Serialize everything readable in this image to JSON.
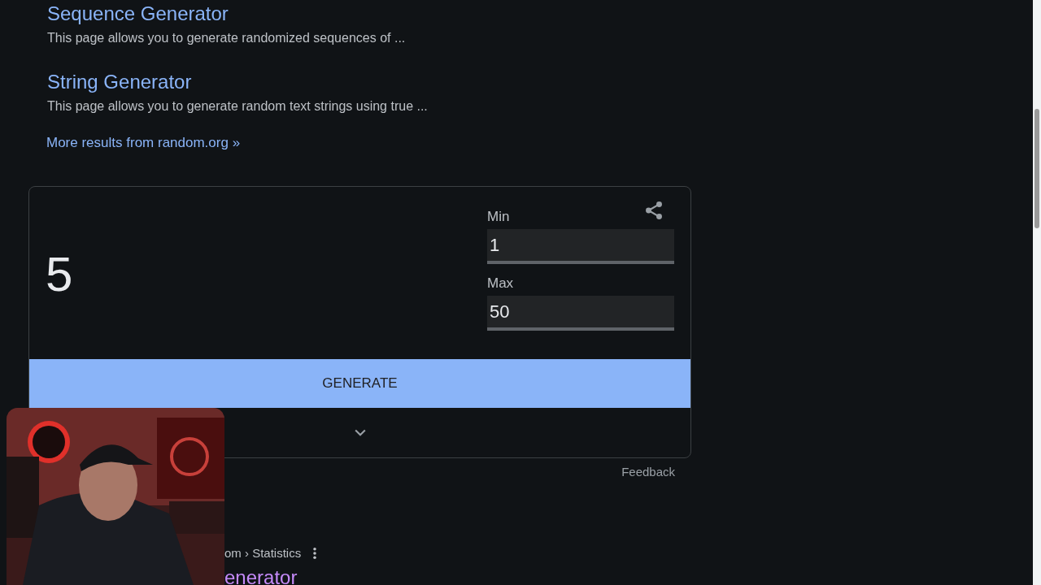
{
  "results": [
    {
      "title": "Sequence Generator",
      "snippet": "This page allows you to generate randomized sequences of ..."
    },
    {
      "title": "String Generator",
      "snippet": "This page allows you to generate random text strings using true ..."
    }
  ],
  "more_link": "More results from random.org »",
  "widget": {
    "result": "5",
    "fields": [
      {
        "label": "Min",
        "value": "1"
      },
      {
        "label": "Max",
        "value": "50"
      }
    ],
    "button": "GENERATE",
    "feedback": "Feedback"
  },
  "next_result": {
    "breadcrumb": "om › Statistics",
    "title": "enerator"
  }
}
